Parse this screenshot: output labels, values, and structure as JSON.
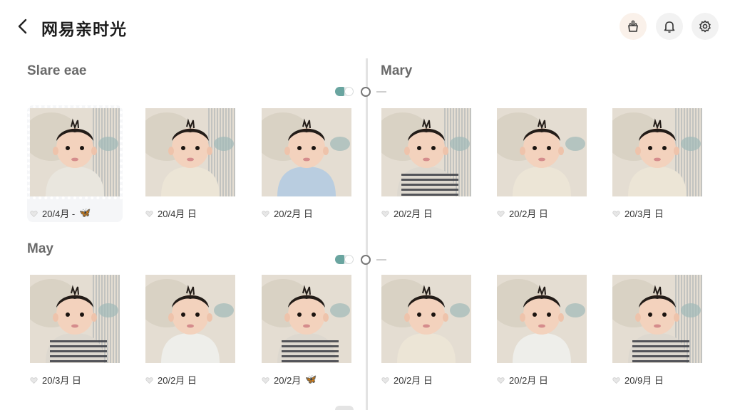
{
  "header": {
    "title": "网易亲时光",
    "buttons": [
      "gift-icon",
      "bell-icon",
      "gear-icon"
    ]
  },
  "sections": [
    {
      "label_left": "Slare eae",
      "label_right": "Mary"
    },
    {
      "label_left": "May",
      "label_right": ""
    }
  ],
  "row1": [
    {
      "date": "20/4月 -",
      "emoji": "🦋",
      "outfit": "light",
      "bg": "striped"
    },
    {
      "date": "20/4月 日",
      "outfit": "cream",
      "bg": "striped"
    },
    {
      "date": "20/2月 日",
      "outfit": "blue",
      "bg": "plain"
    },
    {
      "date": "20/2月 日",
      "outfit": "stripe",
      "bg": "striped"
    },
    {
      "date": "20/2月 日",
      "outfit": "cream",
      "bg": "plain"
    },
    {
      "date": "20/3月 日",
      "outfit": "cream",
      "bg": "striped"
    }
  ],
  "row2": [
    {
      "date": "20/3月 日",
      "outfit": "stripe",
      "bg": "striped"
    },
    {
      "date": "20/2月 日",
      "outfit": "white",
      "bg": "plain"
    },
    {
      "date": "20/2月",
      "emoji": "🦋",
      "outfit": "stripe",
      "bg": "plain"
    },
    {
      "date": "20/2月 日",
      "outfit": "cream",
      "bg": "plain"
    },
    {
      "date": "20/2月 日",
      "outfit": "white",
      "bg": "plain"
    },
    {
      "date": "20/9月 日",
      "outfit": "stripe",
      "bg": "striped"
    }
  ]
}
